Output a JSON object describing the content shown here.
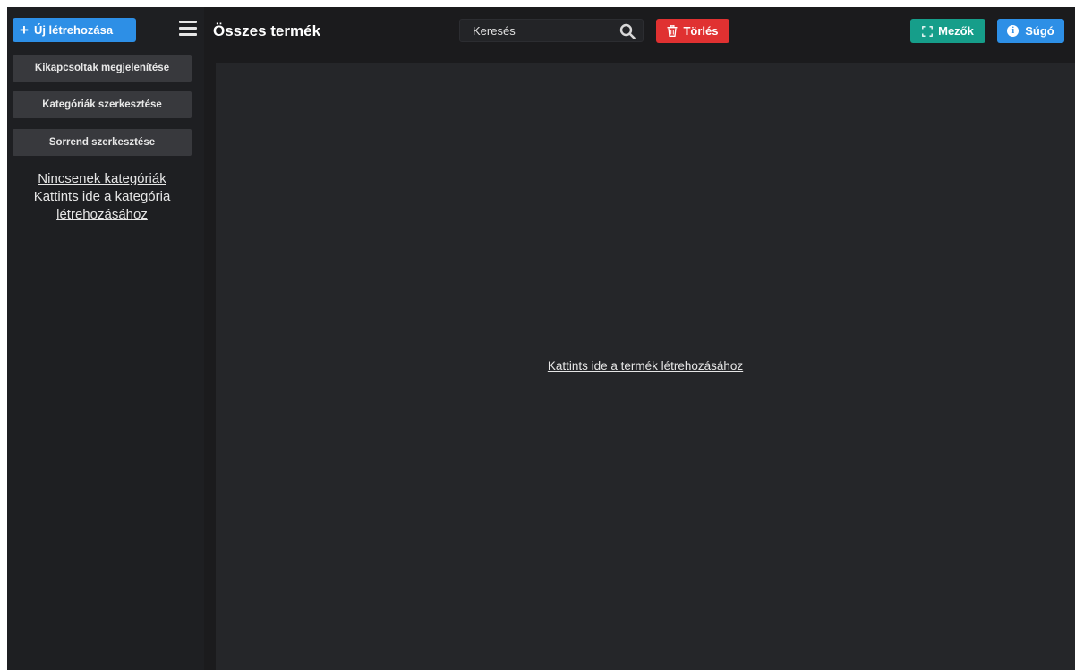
{
  "sidebar": {
    "new_button_label": "Új létrehozása",
    "buttons": [
      {
        "label": "Kikapcsoltak megjelenítése"
      },
      {
        "label": "Kategóriák szerkesztése"
      },
      {
        "label": "Sorrend szerkesztése"
      }
    ],
    "empty_line1": "Nincsenek kategóriák",
    "empty_line2": "Kattints ide a kategória létrehozásához"
  },
  "header": {
    "title": "Összes termék",
    "search_placeholder": "Keresés",
    "delete_label": "Törlés",
    "fields_label": "Mezők",
    "help_label": "Súgó"
  },
  "main": {
    "create_product_link": "Kattints ide a termék létrehozásához"
  },
  "colors": {
    "primary": "#2d8fe6",
    "danger": "#e03131",
    "teal": "#169e8a",
    "background": "#1b1b1d"
  }
}
